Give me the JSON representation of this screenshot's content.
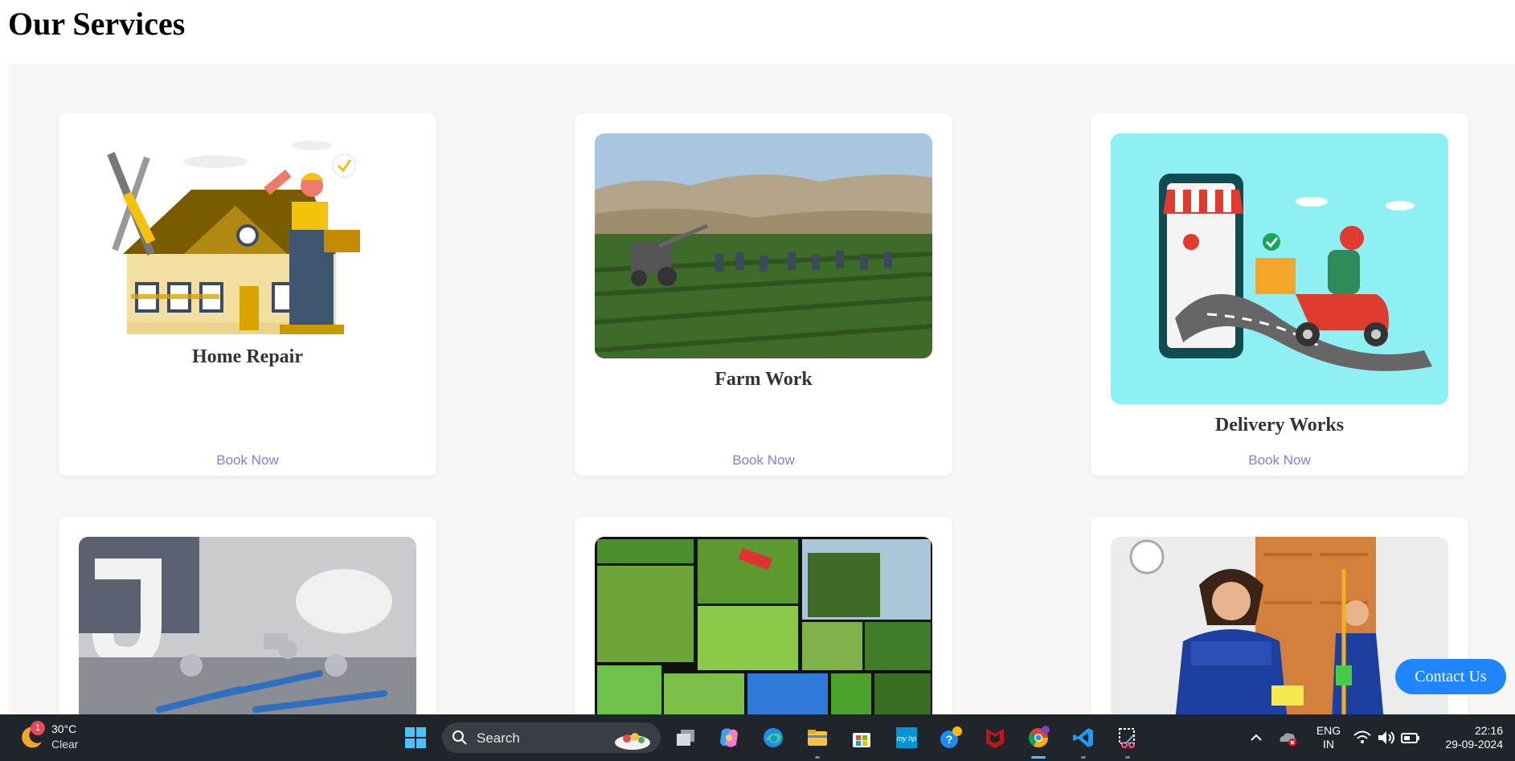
{
  "page": {
    "title": "Our Services"
  },
  "services": [
    {
      "title": "Home Repair",
      "cta": "Book Now"
    },
    {
      "title": "Farm Work",
      "cta": "Book Now"
    },
    {
      "title": "Delivery Works",
      "cta": "Book Now"
    },
    {
      "title": "",
      "cta": ""
    },
    {
      "title": "",
      "cta": ""
    },
    {
      "title": "",
      "cta": ""
    }
  ],
  "contact": {
    "label": "Contact Us"
  },
  "taskbar": {
    "weather": {
      "badge": "1",
      "temp": "30°C",
      "condition": "Clear"
    },
    "search": {
      "placeholder": "Search"
    },
    "pinned_icons": [
      "windows-start-icon",
      "task-view-icon",
      "copilot-icon",
      "edge-icon",
      "file-explorer-icon",
      "microsoft-store-icon",
      "myhp-icon",
      "tips-icon",
      "mcafee-icon",
      "chrome-icon",
      "vscode-icon",
      "snipping-tool-icon"
    ],
    "tray": {
      "language": "ENG",
      "region": "IN",
      "time": "22:16",
      "date": "29-09-2024"
    }
  },
  "colors": {
    "link": "#7b7fe6",
    "contact_button": "#1f86ff",
    "taskbar": "#20242b",
    "section_bg": "#f7f7f7"
  }
}
